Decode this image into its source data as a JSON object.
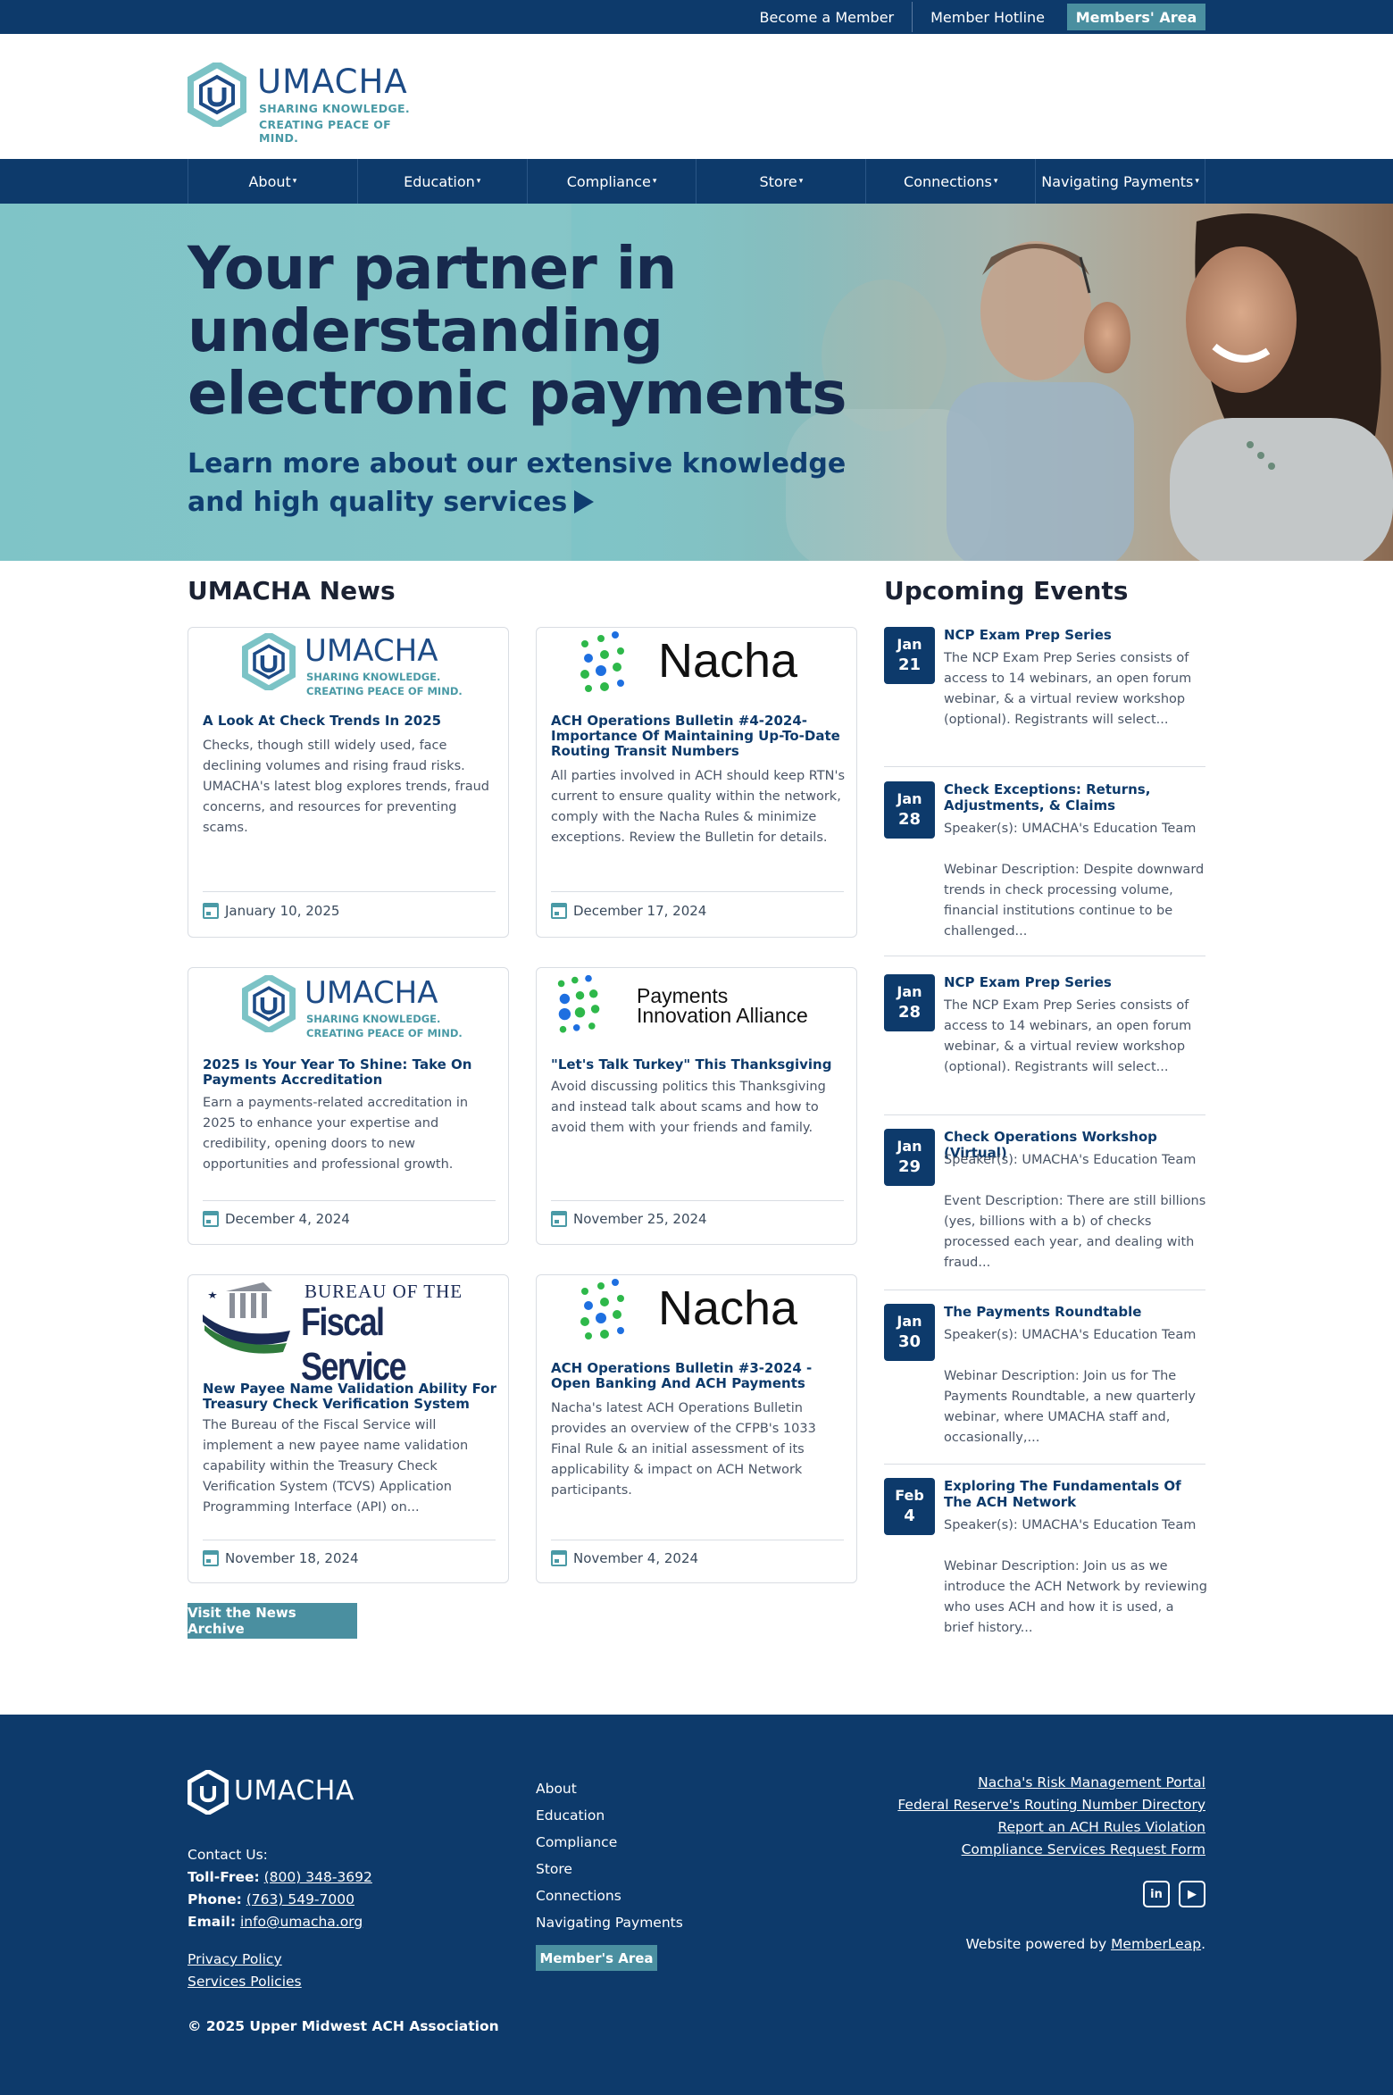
{
  "topbar": {
    "become_member": "Become a Member",
    "hotline": "Member Hotline",
    "members_area": "Members' Area"
  },
  "logo": {
    "word": "UMACHA",
    "tag1": "SHARING KNOWLEDGE.",
    "tag2": "CREATING PEACE OF MIND."
  },
  "nav": {
    "items": [
      "About",
      "Education",
      "Compliance",
      "Store",
      "Connections",
      "Navigating Payments"
    ]
  },
  "hero": {
    "title": "Your partner in understanding electronic payments",
    "subtitle": "Learn more about our extensive knowledge and high quality services"
  },
  "news": {
    "heading": "UMACHA News",
    "archive_button": "Visit the News Archive",
    "cards": [
      {
        "logo": "UMACHA",
        "title": "A Look At Check Trends In 2025",
        "text": "Checks, though still widely used, face declining volumes and rising fraud risks. UMACHA's latest blog explores trends, fraud concerns, and resources for preventing scams.",
        "date": "January 10, 2025"
      },
      {
        "logo": "Nacha",
        "title": "ACH Operations Bulletin #4-2024- Importance Of Maintaining Up-To-Date Routing Transit Numbers",
        "text": "All parties involved in ACH should keep RTN's current to ensure quality within the network, comply with the Nacha Rules & minimize exceptions. Review the Bulletin for details.",
        "date": "December 17, 2024"
      },
      {
        "logo": "UMACHA",
        "title": "2025 Is Your Year To Shine: Take On Payments Accreditation",
        "text": "Earn a payments-related accreditation in 2025 to enhance your expertise and credibility, opening doors to new opportunities and professional growth.",
        "date": "December 4, 2024"
      },
      {
        "logo": "Payments Innovation Alliance",
        "logo_line1": "Payments",
        "logo_line2": "Innovation Alliance",
        "title": "\"Let's Talk Turkey\" This Thanksgiving",
        "text": "Avoid discussing politics this Thanksgiving and instead talk about scams and how to avoid them with your friends and family.",
        "date": "November 25, 2024"
      },
      {
        "logo": "Bureau of the Fiscal Service",
        "logo_line1": "BUREAU OF THE",
        "logo_line2": "Fiscal Service",
        "title": "New Payee Name Validation Ability For Treasury Check Verification System",
        "text": "The Bureau of the Fiscal Service will implement a new payee name validation capability within the Treasury Check Verification System (TCVS) Application Programming Interface (API) on...",
        "date": "November 18, 2024"
      },
      {
        "logo": "Nacha",
        "title": "ACH Operations Bulletin #3-2024 - Open Banking And ACH Payments",
        "text": "Nacha's latest ACH Operations Bulletin provides an overview of the CFPB's 1033 Final Rule & an initial assessment of its applicability & impact on ACH Network participants.",
        "date": "November 4, 2024"
      }
    ]
  },
  "events": {
    "heading": "Upcoming Events",
    "items": [
      {
        "month": "Jan",
        "day": "21",
        "title": "NCP Exam Prep Series",
        "text": "The NCP Exam Prep Series consists of access to 14 webinars, an open forum webinar, & a virtual review workshop (optional).  Registrants will select..."
      },
      {
        "month": "Jan",
        "day": "28",
        "title": "Check Exceptions: Returns, Adjustments, & Claims",
        "speaker": "Speaker(s): UMACHA's Education Team",
        "text": "Webinar Description: Despite downward trends in check processing volume, financial institutions continue to be challenged..."
      },
      {
        "month": "Jan",
        "day": "28",
        "title": "NCP Exam Prep Series",
        "text": "The NCP Exam Prep Series consists of access to 14 webinars, an open forum webinar, & a virtual review workshop (optional).  Registrants will select..."
      },
      {
        "month": "Jan",
        "day": "29",
        "title": "Check Operations Workshop (Virtual)",
        "speaker": "Speaker(s): UMACHA's Education Team",
        "text": "Event Description: There are still billions (yes, billions with a b) of checks processed each year, and dealing with fraud..."
      },
      {
        "month": "Jan",
        "day": "30",
        "title": "The Payments Roundtable",
        "speaker": "Speaker(s): UMACHA's Education Team",
        "text": "Webinar Description: Join us for The Payments Roundtable, a new quarterly webinar, where UMACHA staff and, occasionally,..."
      },
      {
        "month": "Feb",
        "day": "4",
        "title": "Exploring The Fundamentals Of The ACH Network",
        "speaker": "Speaker(s): UMACHA's Education Team",
        "text": "Webinar Description: Join us as we introduce the ACH Network by reviewing who uses ACH and how it is used, a brief history..."
      }
    ]
  },
  "footer": {
    "logo_word": "UMACHA",
    "contact_label": "Contact Us:",
    "tollfree_label": "Toll-Free:",
    "tollfree": "(800) 348-3692",
    "phone_label": "Phone:",
    "phone": "(763) 549-7000",
    "email_label": "Email:",
    "email": "info@umacha.org",
    "privacy": "Privacy Policy",
    "services": "Services Policies",
    "copyright": "© 2025 Upper Midwest ACH Association",
    "nav": [
      "About",
      "Education",
      "Compliance",
      "Store",
      "Connections",
      "Navigating Payments"
    ],
    "members_button": "Member's Area",
    "links": [
      "Nacha's Risk Management Portal",
      "Federal Reserve's Routing Number Directory",
      "Report an ACH Rules Violation",
      "Compliance Services Request Form"
    ],
    "social": [
      "in",
      "▶"
    ],
    "powered_prefix": "Website powered by",
    "powered_link": "MemberLeap",
    "powered_suffix": "."
  },
  "colors": {
    "navy": "#0d3a6b",
    "teal": "#4a8fa0",
    "hero_teal": "#7fc4c7",
    "heading_dark": "#17294d"
  }
}
